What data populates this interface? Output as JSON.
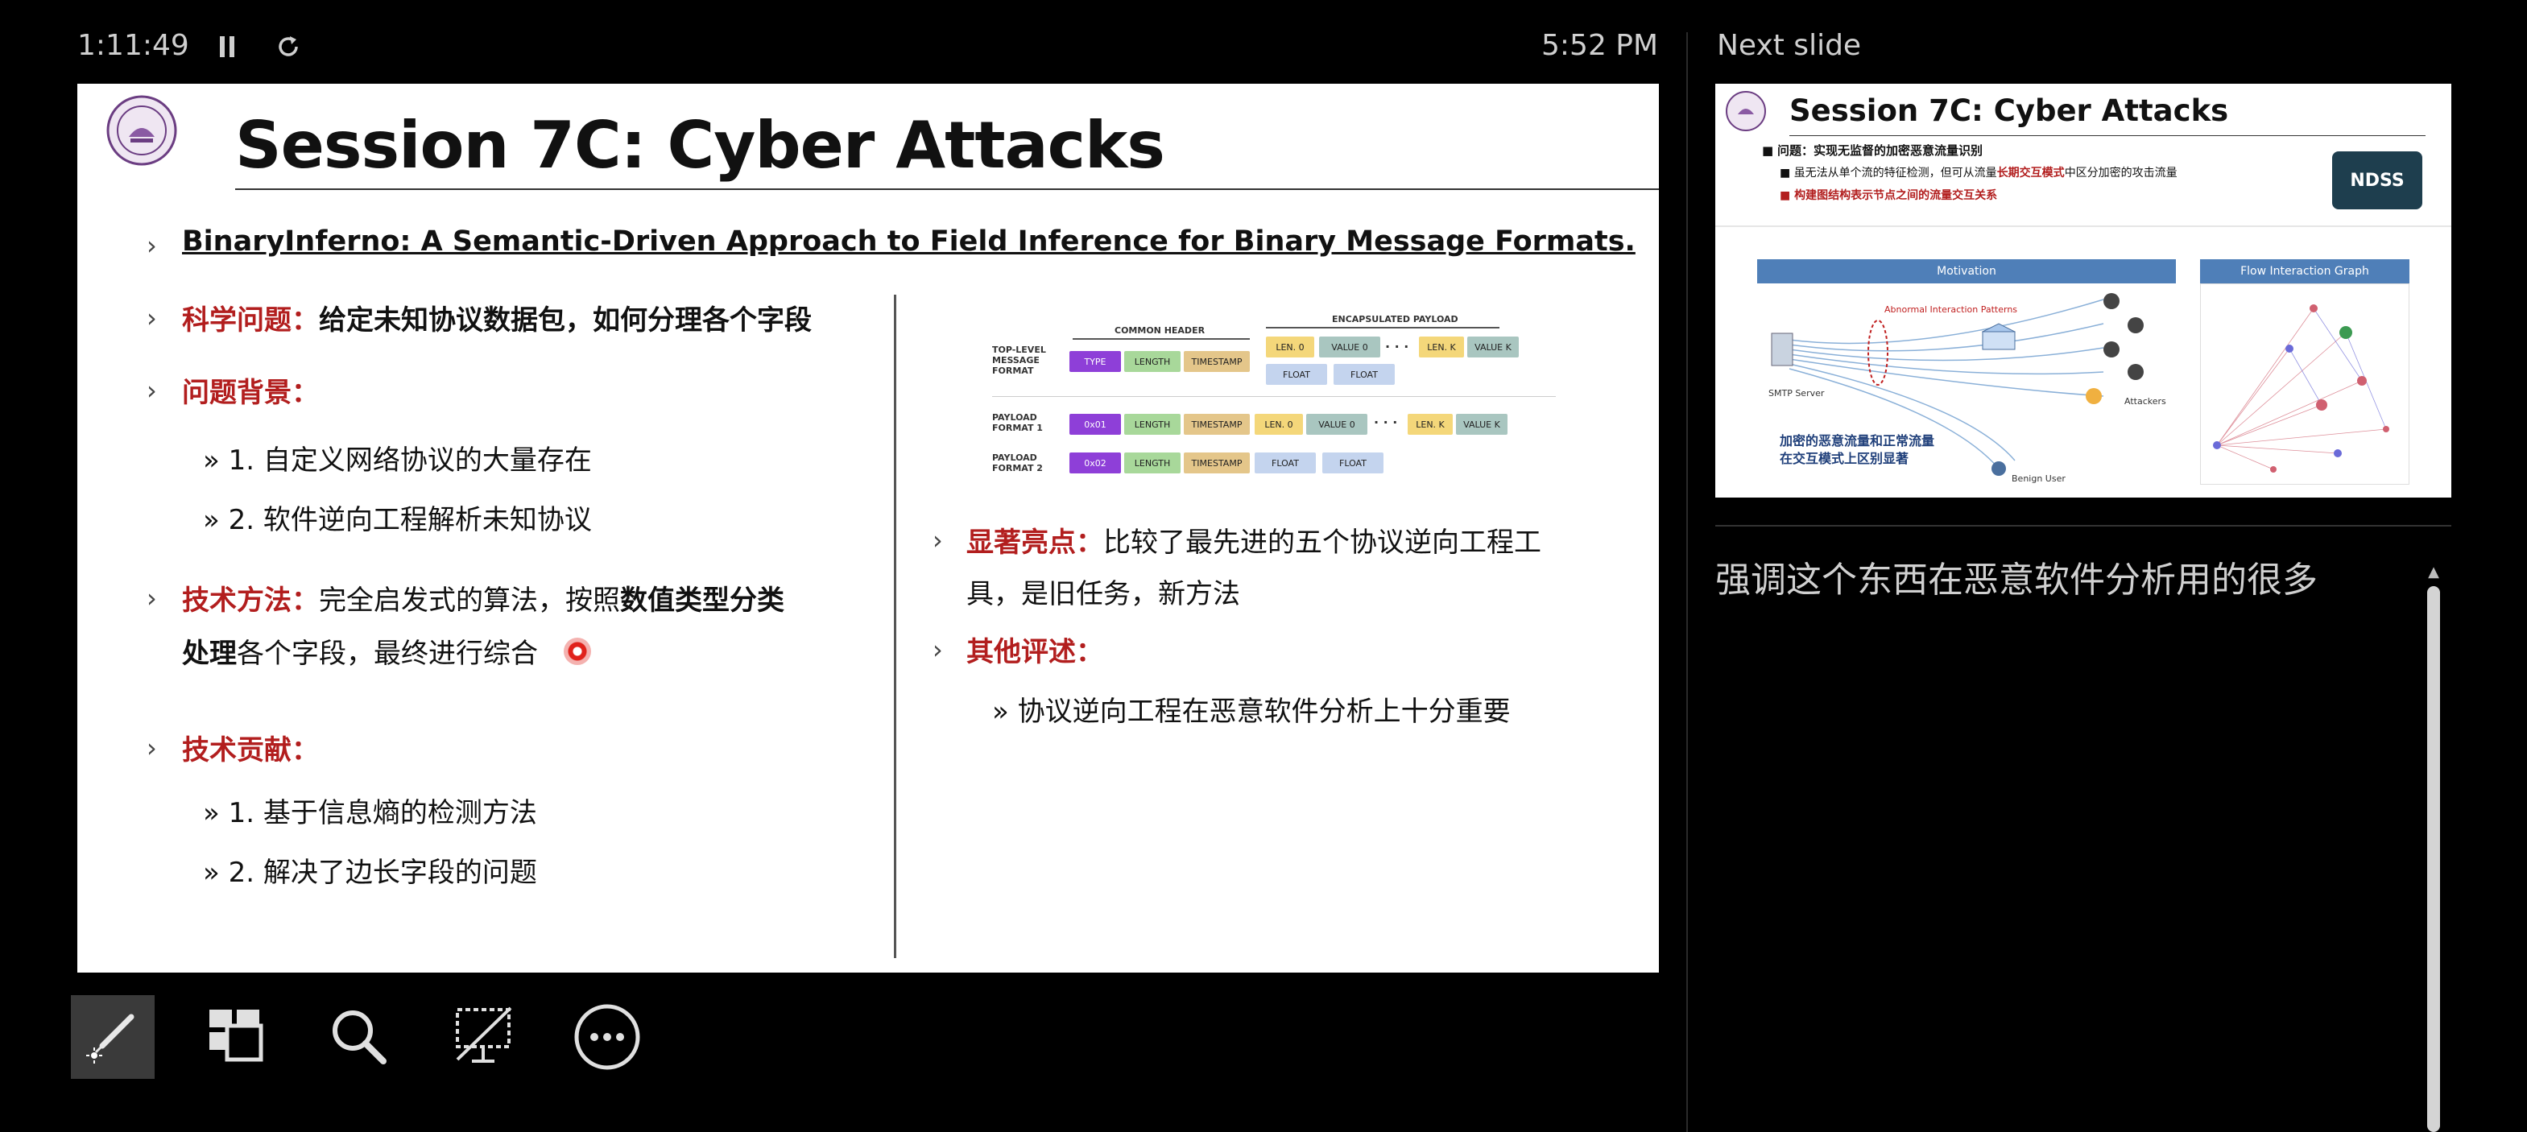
{
  "topbar": {
    "timer": "1:11:49",
    "clock": "5:52 PM",
    "next_slide_label": "Next slide"
  },
  "slide": {
    "title": "Session 7C: Cyber Attacks",
    "paper_title": "BinaryInferno: A Semantic-Driven Approach to Field Inference for Binary Message Formats.",
    "problem_label": "科学问题：",
    "problem_text": "给定未知协议数据包，如何分理各个字段",
    "background_label": "问题背景：",
    "background_items": [
      "1. 自定义网络协议的大量存在",
      "2. 软件逆向工程解析未知协议"
    ],
    "method_label": "技术方法：",
    "method_text1": "完全启发式的算法，按照",
    "method_bold1": "数值类型分类",
    "method_bold2": "处理",
    "method_text2": "各个字段，最终进行综合",
    "contrib_label": "技术贡献：",
    "contrib_items": [
      "1. 基于信息熵的检测方法",
      "2. 解决了边长字段的问题"
    ],
    "highlight_label": "显著亮点：",
    "highlight_text1": "比较了最先进的五个协议逆向工程工",
    "highlight_text2": "具，是旧任务，新方法",
    "other_label": "其他评述：",
    "other_items": [
      "协议逆向工程在恶意软件分析上十分重要"
    ],
    "diagram": {
      "common_header": "COMMON HEADER",
      "encapsulated_payload": "ENCAPSULATED PAYLOAD",
      "row_labels": [
        "TOP-LEVEL MESSAGE FORMAT",
        "PAYLOAD FORMAT 1",
        "PAYLOAD FORMAT 2"
      ],
      "type": "TYPE",
      "length": "LENGTH",
      "timestamp": "TIMESTAMP",
      "len0": "LEN. 0",
      "value0": "VALUE 0",
      "lenk": "LEN. K",
      "valuek": "VALUE K",
      "float": "FLOAT",
      "code1": "0x01",
      "code2": "0x02",
      "dots": "· · ·"
    }
  },
  "next_slide": {
    "title": "Session 7C: Cyber Attacks",
    "line1_label": "问题：",
    "line1_text": "实现无监督的加密恶意流量识别",
    "line2a": "虽无法从单个流的特征检测，但可从流量",
    "line2b": "长期交互模式",
    "line2c": "中区分加密的攻击流量",
    "line3": "构建图结构表示节点之间的流量交互关系",
    "badge": "NDSS",
    "motivation": "Motivation",
    "flow_graph": "Flow Interaction Graph",
    "abnormal": "Abnormal Interaction Patterns",
    "smtp": "SMTP Server",
    "attackers": "Attackers",
    "benign": "Benign User",
    "caption1": "加密的恶意流量和正常流量",
    "caption2": "在交互模式上区别显著"
  },
  "notes": {
    "text": "强调这个东西在恶意软件分析用的很多"
  },
  "toolbar": {
    "icons": [
      "pen-tool-icon",
      "slides-grid-icon",
      "zoom-icon",
      "black-screen-icon",
      "more-options-icon"
    ]
  },
  "colors": {
    "accent_red": "#b21e1e",
    "background": "#000000"
  }
}
